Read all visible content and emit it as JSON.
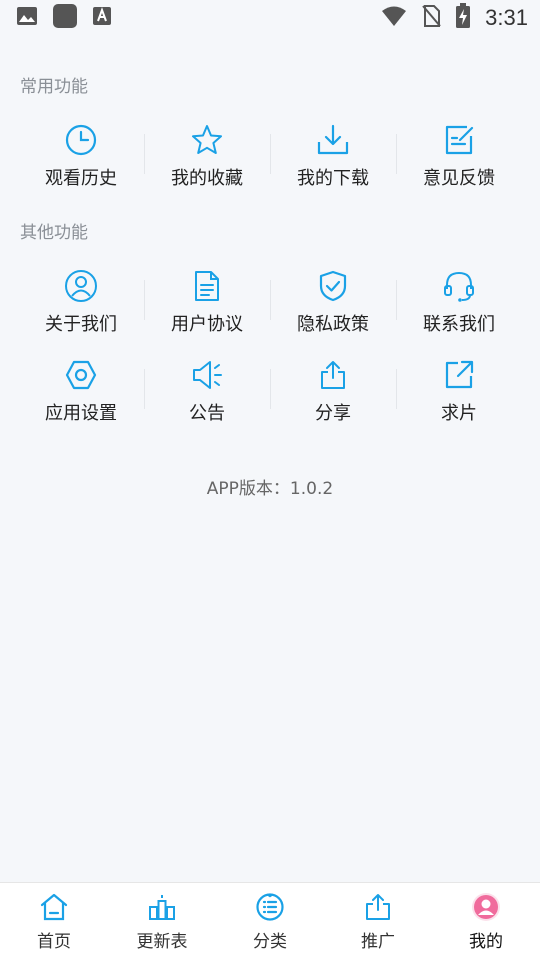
{
  "statusbar": {
    "time": "3:31"
  },
  "sections": {
    "common_title": "常用功能",
    "other_title": "其他功能"
  },
  "common": [
    {
      "label": "观看历史",
      "icon": "clock-icon"
    },
    {
      "label": "我的收藏",
      "icon": "star-icon"
    },
    {
      "label": "我的下载",
      "icon": "download-icon"
    },
    {
      "label": "意见反馈",
      "icon": "edit-icon"
    }
  ],
  "other_row1": [
    {
      "label": "关于我们",
      "icon": "user-icon"
    },
    {
      "label": "用户协议",
      "icon": "document-icon"
    },
    {
      "label": "隐私政策",
      "icon": "shield-check-icon"
    },
    {
      "label": "联系我们",
      "icon": "headset-icon"
    }
  ],
  "other_row2": [
    {
      "label": "应用设置",
      "icon": "hexagon-settings-icon"
    },
    {
      "label": "公告",
      "icon": "speaker-icon"
    },
    {
      "label": "分享",
      "icon": "share-icon"
    },
    {
      "label": "求片",
      "icon": "external-link-icon"
    }
  ],
  "version_text": "APP版本：1.0.2",
  "tabs": [
    {
      "label": "首页",
      "icon": "home-icon"
    },
    {
      "label": "更新表",
      "icon": "schedule-icon"
    },
    {
      "label": "分类",
      "icon": "category-icon"
    },
    {
      "label": "推广",
      "icon": "share-icon"
    },
    {
      "label": "我的",
      "icon": "profile-icon"
    }
  ],
  "colors": {
    "accent": "#1aa1e6",
    "active_tab": "#f06b9c",
    "background": "#f5f7fa"
  }
}
